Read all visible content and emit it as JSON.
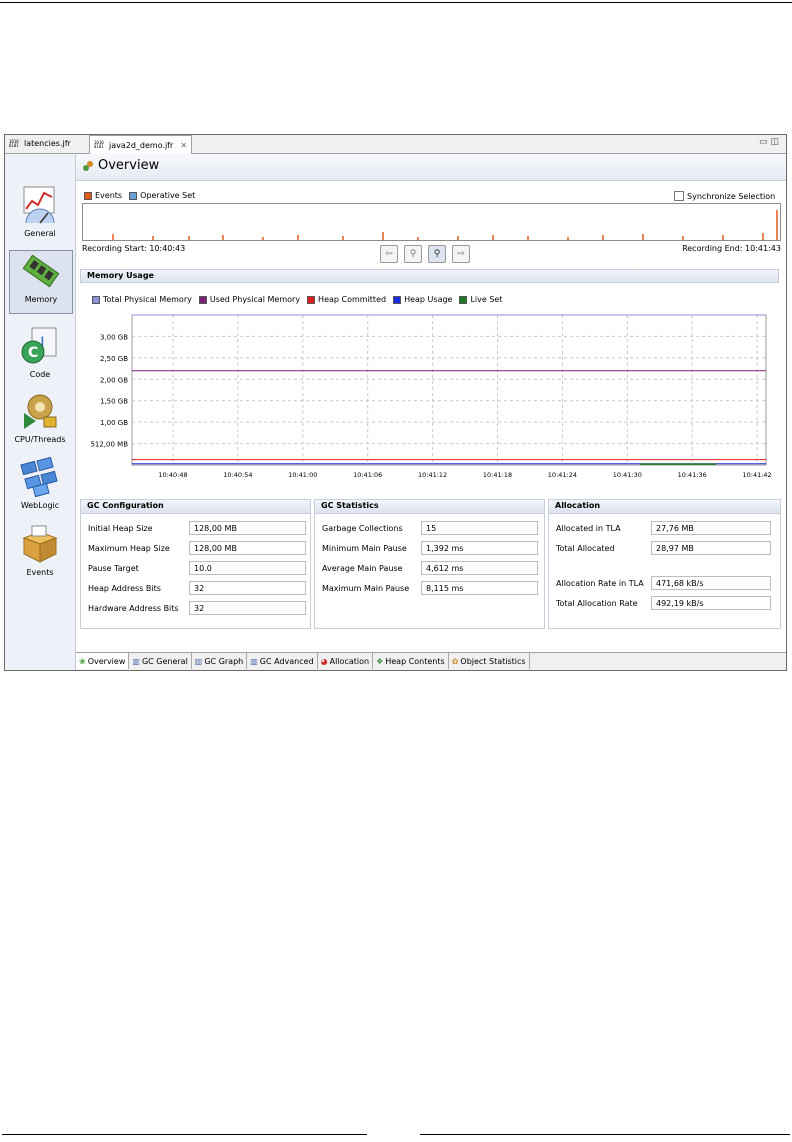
{
  "editor_tabs": [
    {
      "label": "latencies.jfr",
      "active": false
    },
    {
      "label": "java2d_demo.jfr",
      "active": true
    }
  ],
  "sidebar": {
    "items": [
      {
        "label": "General",
        "icon": "chart-gauge-icon"
      },
      {
        "label": "Memory",
        "icon": "memory-chip-icon",
        "selected": true
      },
      {
        "label": "Code",
        "icon": "java-code-icon"
      },
      {
        "label": "CPU/Threads",
        "icon": "gear-lock-icon"
      },
      {
        "label": "WebLogic",
        "icon": "weblogic-grid-icon"
      },
      {
        "label": "Events",
        "icon": "box-icon"
      }
    ]
  },
  "overview": {
    "title": "Overview",
    "legend_events": "Events",
    "legend_operative": "Operative Set",
    "sync_label": "Synchronize Selection",
    "recording_start": "Recording Start: 10:40:43",
    "recording_end": "Recording End: 10:41:43",
    "colors": {
      "events": "#e05a1c",
      "operative": "#6aa3d8"
    }
  },
  "memory_usage": {
    "title": "Memory Usage",
    "legend": [
      {
        "name": "Total Physical Memory",
        "color": "#8f8fdc"
      },
      {
        "name": "Used Physical Memory",
        "color": "#7b1f7b"
      },
      {
        "name": "Heap Committed",
        "color": "#e02020"
      },
      {
        "name": "Heap Usage",
        "color": "#1a2ee0"
      },
      {
        "name": "Live Set",
        "color": "#1f7a1f"
      }
    ]
  },
  "chart_data": {
    "type": "line",
    "title": "Memory Usage",
    "y_ticks": [
      "3,00 GB",
      "2,50 GB",
      "2,00 GB",
      "1,50 GB",
      "1,00 GB",
      "512,00 MB"
    ],
    "x_ticks": [
      "10:40:48",
      "10:40:54",
      "10:41:00",
      "10:41:06",
      "10:41:12",
      "10:41:18",
      "10:41:24",
      "10:41:30",
      "10:41:36",
      "10:41:42"
    ],
    "ylim_gb": [
      0,
      3.5
    ],
    "grid": true,
    "series": [
      {
        "name": "Total Physical Memory",
        "values_gb": [
          3.5,
          3.5
        ]
      },
      {
        "name": "Used Physical Memory",
        "values_gb": [
          2.2,
          2.2
        ]
      },
      {
        "name": "Heap Committed",
        "values_gb": [
          0.125,
          0.125
        ]
      },
      {
        "name": "Heap Usage",
        "values_gb": [
          0.03,
          0.03
        ]
      },
      {
        "name": "Live Set",
        "values_gb": [
          0.0,
          0.02
        ]
      }
    ]
  },
  "gc_configuration": {
    "title": "GC Configuration",
    "fields": [
      {
        "label": "Initial Heap Size",
        "value": "128,00 MB"
      },
      {
        "label": "Maximum Heap Size",
        "value": "128,00 MB"
      },
      {
        "label": "Pause Target",
        "value": "10.0"
      },
      {
        "label": "Heap Address Bits",
        "value": "32"
      },
      {
        "label": "Hardware Address Bits",
        "value": "32"
      }
    ]
  },
  "gc_statistics": {
    "title": "GC Statistics",
    "fields": [
      {
        "label": "Garbage Collections",
        "value": "15"
      },
      {
        "label": "Minimum Main Pause",
        "value": "1,392 ms"
      },
      {
        "label": "Average Main Pause",
        "value": "4,612 ms"
      },
      {
        "label": "Maximum Main Pause",
        "value": "8,115 ms"
      }
    ]
  },
  "allocation": {
    "title": "Allocation",
    "fields": [
      {
        "label": "Allocated in TLA",
        "value": "27,76 MB"
      },
      {
        "label": "Total Allocated",
        "value": "28,97 MB"
      },
      {
        "label": "Allocation Rate in TLA",
        "value": "471,68 kB/s"
      },
      {
        "label": "Total Allocation Rate",
        "value": "492,19 kB/s"
      }
    ]
  },
  "bottom_tabs": [
    {
      "label": "Overview",
      "active": true
    },
    {
      "label": "GC General"
    },
    {
      "label": "GC Graph"
    },
    {
      "label": "GC Advanced"
    },
    {
      "label": "Allocation"
    },
    {
      "label": "Heap Contents"
    },
    {
      "label": "Object Statistics"
    }
  ]
}
